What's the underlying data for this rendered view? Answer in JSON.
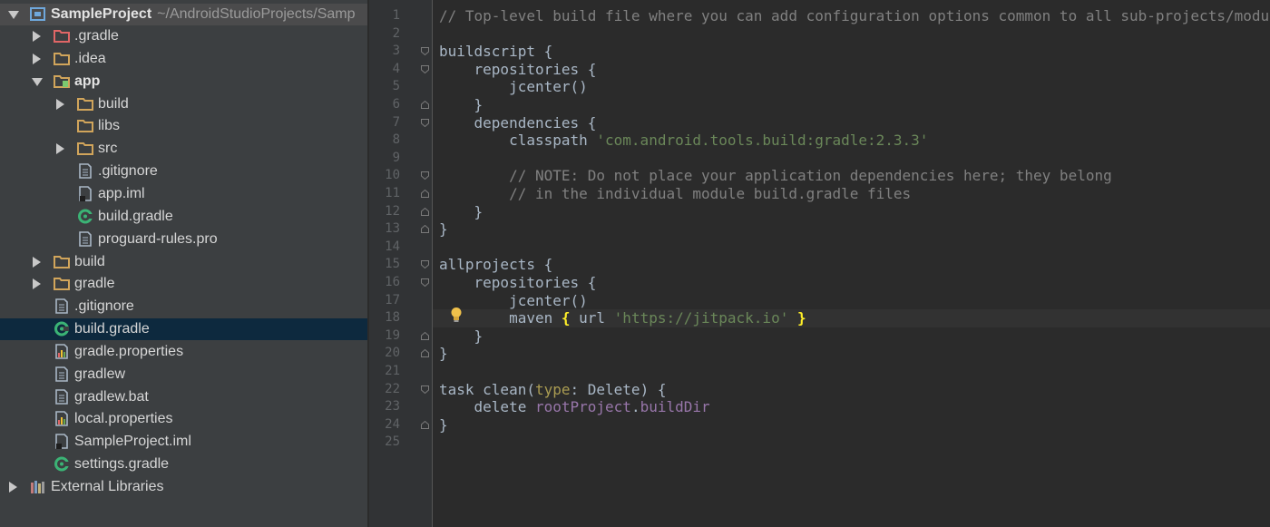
{
  "project_tree": {
    "root": {
      "name": "SampleProject",
      "path": "~/AndroidStudioProjects/Samp"
    },
    "items": [
      {
        "label": ".gradle",
        "type": "folder-gradle",
        "arrow": "right",
        "depth": 1
      },
      {
        "label": ".idea",
        "type": "folder",
        "arrow": "right",
        "depth": 1
      },
      {
        "label": "app",
        "type": "module",
        "arrow": "down",
        "depth": 1,
        "bold": true
      },
      {
        "label": "build",
        "type": "folder",
        "arrow": "right",
        "depth": 2
      },
      {
        "label": "libs",
        "type": "folder",
        "arrow": "none",
        "depth": 2
      },
      {
        "label": "src",
        "type": "folder",
        "arrow": "right",
        "depth": 2
      },
      {
        "label": ".gitignore",
        "type": "file",
        "arrow": "none",
        "depth": 2
      },
      {
        "label": "app.iml",
        "type": "iml",
        "arrow": "none",
        "depth": 2
      },
      {
        "label": "build.gradle",
        "type": "gradle",
        "arrow": "none",
        "depth": 2
      },
      {
        "label": "proguard-rules.pro",
        "type": "file",
        "arrow": "none",
        "depth": 2
      },
      {
        "label": "build",
        "type": "folder",
        "arrow": "right",
        "depth": 1
      },
      {
        "label": "gradle",
        "type": "folder",
        "arrow": "right",
        "depth": 1
      },
      {
        "label": ".gitignore",
        "type": "file",
        "arrow": "none",
        "depth": 1
      },
      {
        "label": "build.gradle",
        "type": "gradle",
        "arrow": "none",
        "depth": 1,
        "selected": true
      },
      {
        "label": "gradle.properties",
        "type": "properties",
        "arrow": "none",
        "depth": 1
      },
      {
        "label": "gradlew",
        "type": "file",
        "arrow": "none",
        "depth": 1
      },
      {
        "label": "gradlew.bat",
        "type": "file",
        "arrow": "none",
        "depth": 1
      },
      {
        "label": "local.properties",
        "type": "properties",
        "arrow": "none",
        "depth": 1
      },
      {
        "label": "SampleProject.iml",
        "type": "iml",
        "arrow": "none",
        "depth": 1
      },
      {
        "label": "settings.gradle",
        "type": "gradle",
        "arrow": "none",
        "depth": 1
      },
      {
        "label": "External Libraries",
        "type": "libraries",
        "arrow": "right",
        "depth": 0
      }
    ]
  },
  "editor": {
    "current_line": 18,
    "lines": [
      {
        "n": "1",
        "tokens": [
          [
            "comment",
            "// Top-level build file where you can add configuration options common to all sub-projects/modules."
          ]
        ]
      },
      {
        "n": "2",
        "tokens": []
      },
      {
        "n": "3",
        "fold": "open",
        "tokens": [
          [
            "plain",
            "buildscript {"
          ]
        ]
      },
      {
        "n": "4",
        "fold": "open",
        "tokens": [
          [
            "plain",
            "    repositories {"
          ]
        ]
      },
      {
        "n": "5",
        "tokens": [
          [
            "plain",
            "        jcenter()"
          ]
        ]
      },
      {
        "n": "6",
        "fold": "close",
        "tokens": [
          [
            "plain",
            "    }"
          ]
        ]
      },
      {
        "n": "7",
        "fold": "open",
        "tokens": [
          [
            "plain",
            "    dependencies {"
          ]
        ]
      },
      {
        "n": "8",
        "tokens": [
          [
            "plain",
            "        classpath "
          ],
          [
            "string",
            "'com.android.tools.build:gradle:2.3.3'"
          ]
        ]
      },
      {
        "n": "9",
        "tokens": []
      },
      {
        "n": "10",
        "fold": "open",
        "tokens": [
          [
            "plain",
            "        "
          ],
          [
            "comment",
            "// NOTE: Do not place your application dependencies here; they belong"
          ]
        ]
      },
      {
        "n": "11",
        "fold": "close",
        "tokens": [
          [
            "plain",
            "        "
          ],
          [
            "comment",
            "// in the individual module build.gradle files"
          ]
        ]
      },
      {
        "n": "12",
        "fold": "close",
        "tokens": [
          [
            "plain",
            "    }"
          ]
        ]
      },
      {
        "n": "13",
        "fold": "close",
        "tokens": [
          [
            "plain",
            "}"
          ]
        ]
      },
      {
        "n": "14",
        "tokens": []
      },
      {
        "n": "15",
        "fold": "open",
        "tokens": [
          [
            "plain",
            "allprojects {"
          ]
        ]
      },
      {
        "n": "16",
        "fold": "open",
        "tokens": [
          [
            "plain",
            "    repositories {"
          ]
        ]
      },
      {
        "n": "17",
        "tokens": [
          [
            "plain",
            "        jcenter()"
          ]
        ]
      },
      {
        "n": "18",
        "tokens": [
          [
            "plain",
            "        maven "
          ],
          [
            "brace",
            "{"
          ],
          [
            "plain",
            " url "
          ],
          [
            "string",
            "'https://jitpack.io'"
          ],
          [
            "plain",
            " "
          ],
          [
            "brace",
            "}"
          ]
        ]
      },
      {
        "n": "19",
        "fold": "close",
        "tokens": [
          [
            "plain",
            "    }"
          ]
        ]
      },
      {
        "n": "20",
        "fold": "close",
        "tokens": [
          [
            "plain",
            "}"
          ]
        ]
      },
      {
        "n": "21",
        "tokens": []
      },
      {
        "n": "22",
        "fold": "open",
        "tokens": [
          [
            "plain",
            "task clean("
          ],
          [
            "param",
            "type"
          ],
          [
            "plain",
            ": Delete) {"
          ]
        ]
      },
      {
        "n": "23",
        "tokens": [
          [
            "plain",
            "    delete "
          ],
          [
            "field",
            "rootProject"
          ],
          [
            "plain",
            "."
          ],
          [
            "field",
            "buildDir"
          ]
        ]
      },
      {
        "n": "24",
        "fold": "close",
        "tokens": [
          [
            "plain",
            "}"
          ]
        ]
      },
      {
        "n": "25",
        "tokens": []
      }
    ],
    "intention_icon": "lightbulb-icon"
  },
  "colors": {
    "panel_bg": "#3c3f41",
    "editor_bg": "#2b2b2b",
    "selection": "#0d293e",
    "folder": "#d1a55b",
    "gradle_green": "#3bb375"
  }
}
